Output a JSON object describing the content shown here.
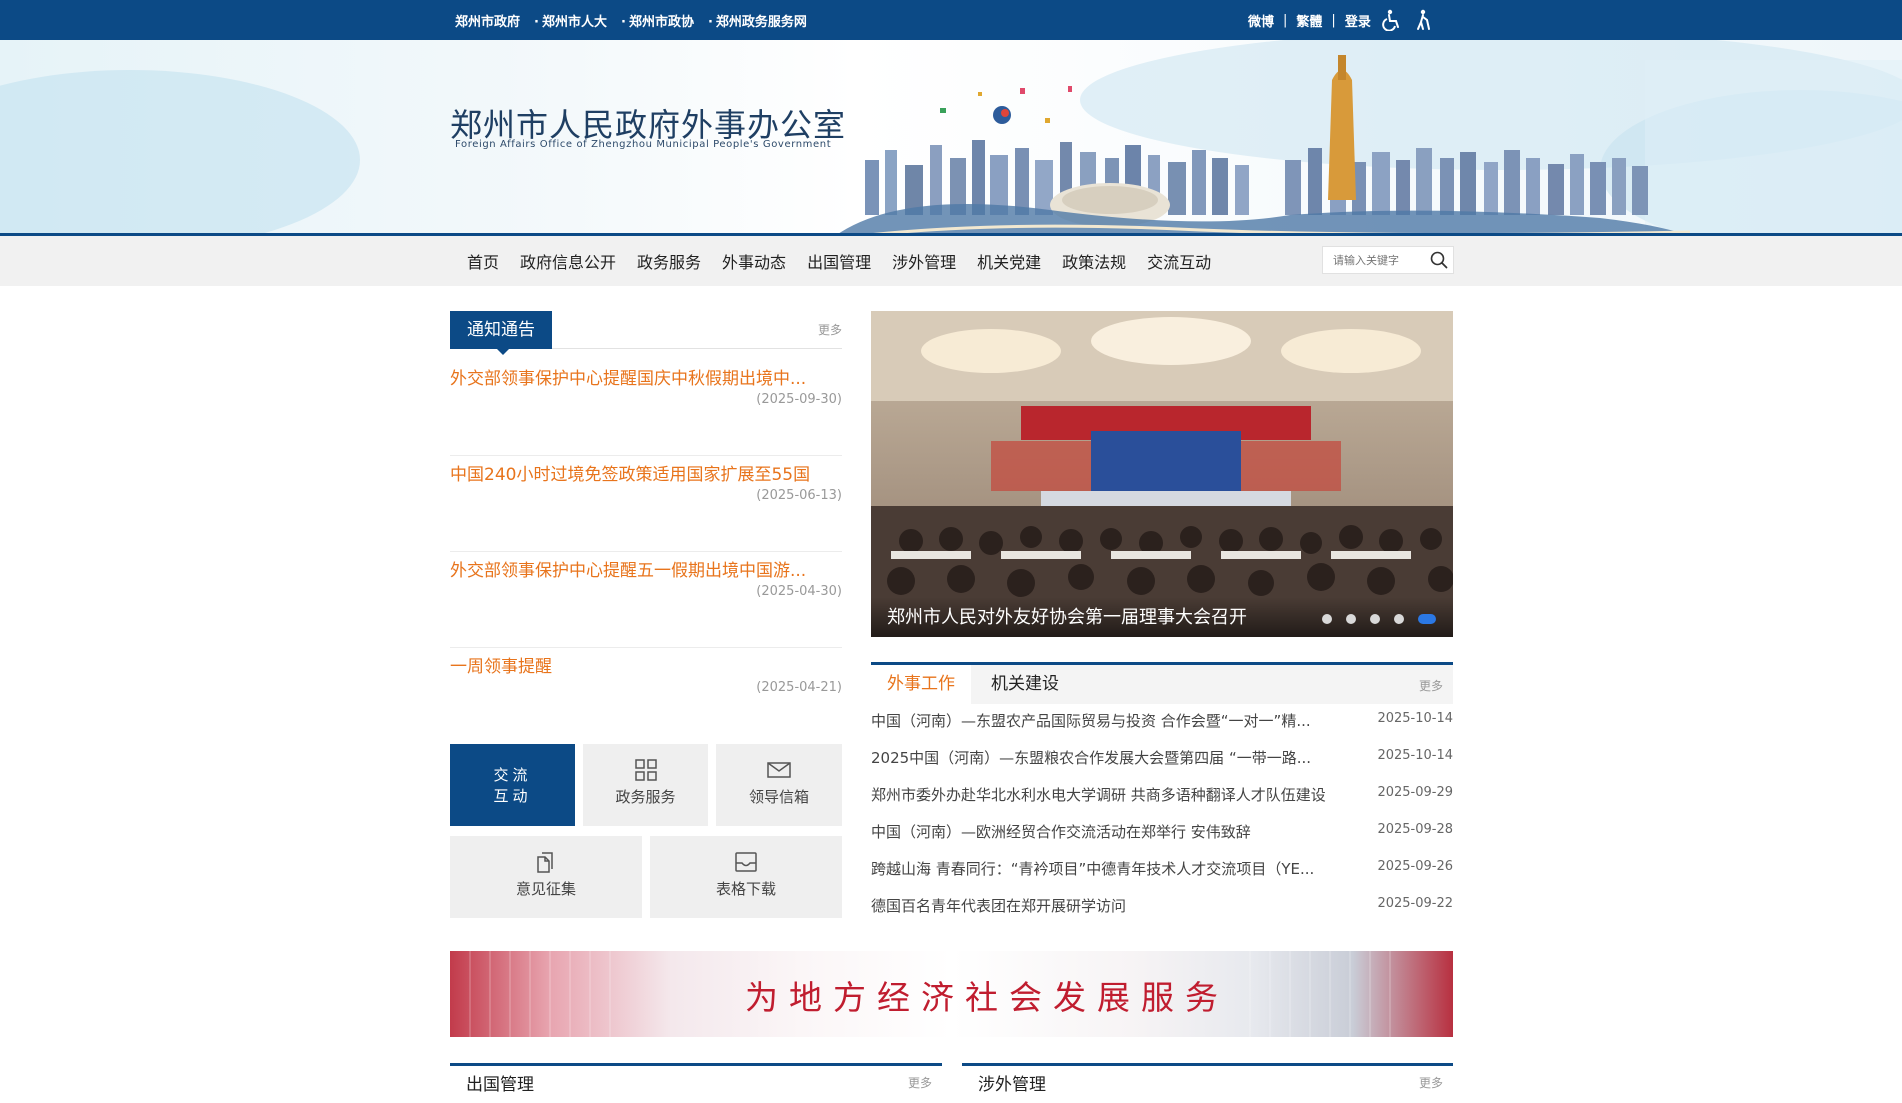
{
  "top_links": [
    "郑州市政府",
    "郑州市人大",
    "郑州市政协",
    "郑州政务服务网"
  ],
  "top_right": {
    "weibo": "微博",
    "traditional": "繁體",
    "login": "登录"
  },
  "site": {
    "title": "郑州市人民政府外事办公室",
    "subtitle": "Foreign Affairs Office of Zhengzhou Municipal People's Government"
  },
  "nav": [
    "首页",
    "政府信息公开",
    "政务服务",
    "外事动态",
    "出国管理",
    "涉外管理",
    "机关党建",
    "政策法规",
    "交流互动"
  ],
  "search": {
    "placeholder": "请输入关键字"
  },
  "notices": {
    "tab": "通知通告",
    "more": "更多",
    "items": [
      {
        "title": "外交部领事保护中心提醒国庆中秋假期出境中...",
        "date": "(2025-09-30)"
      },
      {
        "title": "中国240小时过境免签政策适用国家扩展至55国",
        "date": "(2025-06-13)"
      },
      {
        "title": "外交部领事保护中心提醒五一假期出境中国游...",
        "date": "(2025-04-30)"
      },
      {
        "title": "一周领事提醒",
        "date": "(2025-04-21)"
      }
    ]
  },
  "tiles": {
    "interact_line1": "交流",
    "interact_line2": "互动",
    "service": "政务服务",
    "mailbox": "领导信箱",
    "feedback": "意见征集",
    "forms": "表格下载"
  },
  "carousel": {
    "caption": "郑州市人民对外友好协会第一届理事大会召开",
    "slide_count": 5,
    "active_index": 4
  },
  "news": {
    "tabs": [
      "外事工作",
      "机关建设"
    ],
    "more": "更多",
    "items": [
      {
        "title": "中国（河南）—东盟农产品国际贸易与投资 合作会暨“一对一”精...",
        "date": "2025-10-14"
      },
      {
        "title": "2025中国（河南）—东盟粮农合作发展大会暨第四届 “一带一路...",
        "date": "2025-10-14"
      },
      {
        "title": "郑州市委外办赴华北水利水电大学调研 共商多语种翻译人才队伍建设",
        "date": "2025-09-29"
      },
      {
        "title": "中国（河南）—欧洲经贸合作交流活动在郑举行 安伟致辞",
        "date": "2025-09-28"
      },
      {
        "title": "跨越山海 青春同行：“青衿项目”中德青年技术人才交流项目（YE...",
        "date": "2025-09-26"
      },
      {
        "title": "德国百名青年代表团在郑开展研学访问",
        "date": "2025-09-22"
      }
    ]
  },
  "slogan": "为地方经济社会发展服务",
  "bottom_panels": [
    {
      "title": "出国管理",
      "more": "更多"
    },
    {
      "title": "涉外管理",
      "more": "更多"
    }
  ],
  "colors": {
    "primary": "#0c4a86",
    "accent": "#e8741c",
    "slogan_red": "#c01d2f"
  }
}
